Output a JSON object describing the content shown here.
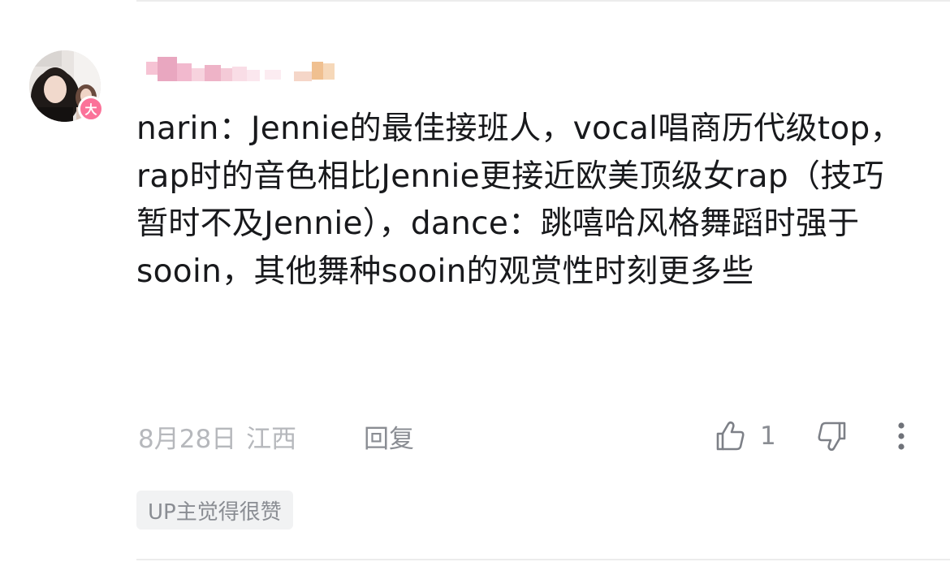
{
  "comment": {
    "avatar_badge": "大",
    "text": "narin：Jennie的最佳接班人，vocal唱商历代级top，rap时的音色相比Jennie更接近欧美顶级女rap（技巧暂时不及Jennie），dance：跳嘻哈风格舞蹈时强于sooin，其他舞种sooin的观赏性时刻更多些",
    "date": "8月28日",
    "location": "江西",
    "reply_label": "回复",
    "like_count": "1",
    "up_tag": "UP主觉得很赞"
  },
  "colors": {
    "text": "#18191c",
    "meta": "#b6b8bc",
    "action": "#8a8d93",
    "badge": "#fb7299",
    "tag_bg": "#f1f2f3"
  },
  "icons": {
    "like": "thumbs-up-icon",
    "dislike": "thumbs-down-icon",
    "more": "more-vertical-icon"
  }
}
